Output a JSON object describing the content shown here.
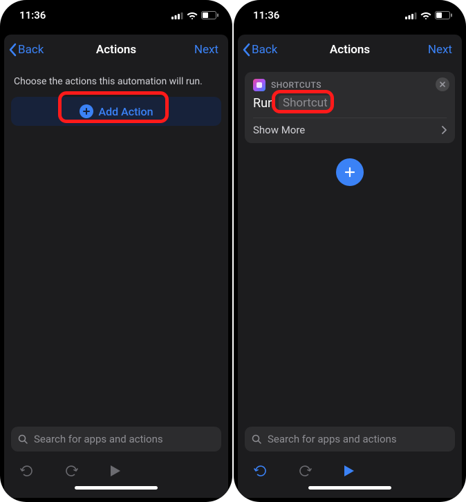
{
  "status": {
    "time": "11:36"
  },
  "nav": {
    "back": "Back",
    "title": "Actions",
    "next": "Next"
  },
  "left": {
    "instruction": "Choose the actions this automation will run.",
    "add_action": "Add Action"
  },
  "right": {
    "card": {
      "header": "SHORTCUTS",
      "run": "Run",
      "token": "Shortcut",
      "show_more": "Show More"
    }
  },
  "search": {
    "placeholder": "Search for apps and actions"
  },
  "colors": {
    "accent": "#3b82f6",
    "inactive": "#6b6b70",
    "highlight": "#ff1a1a"
  }
}
